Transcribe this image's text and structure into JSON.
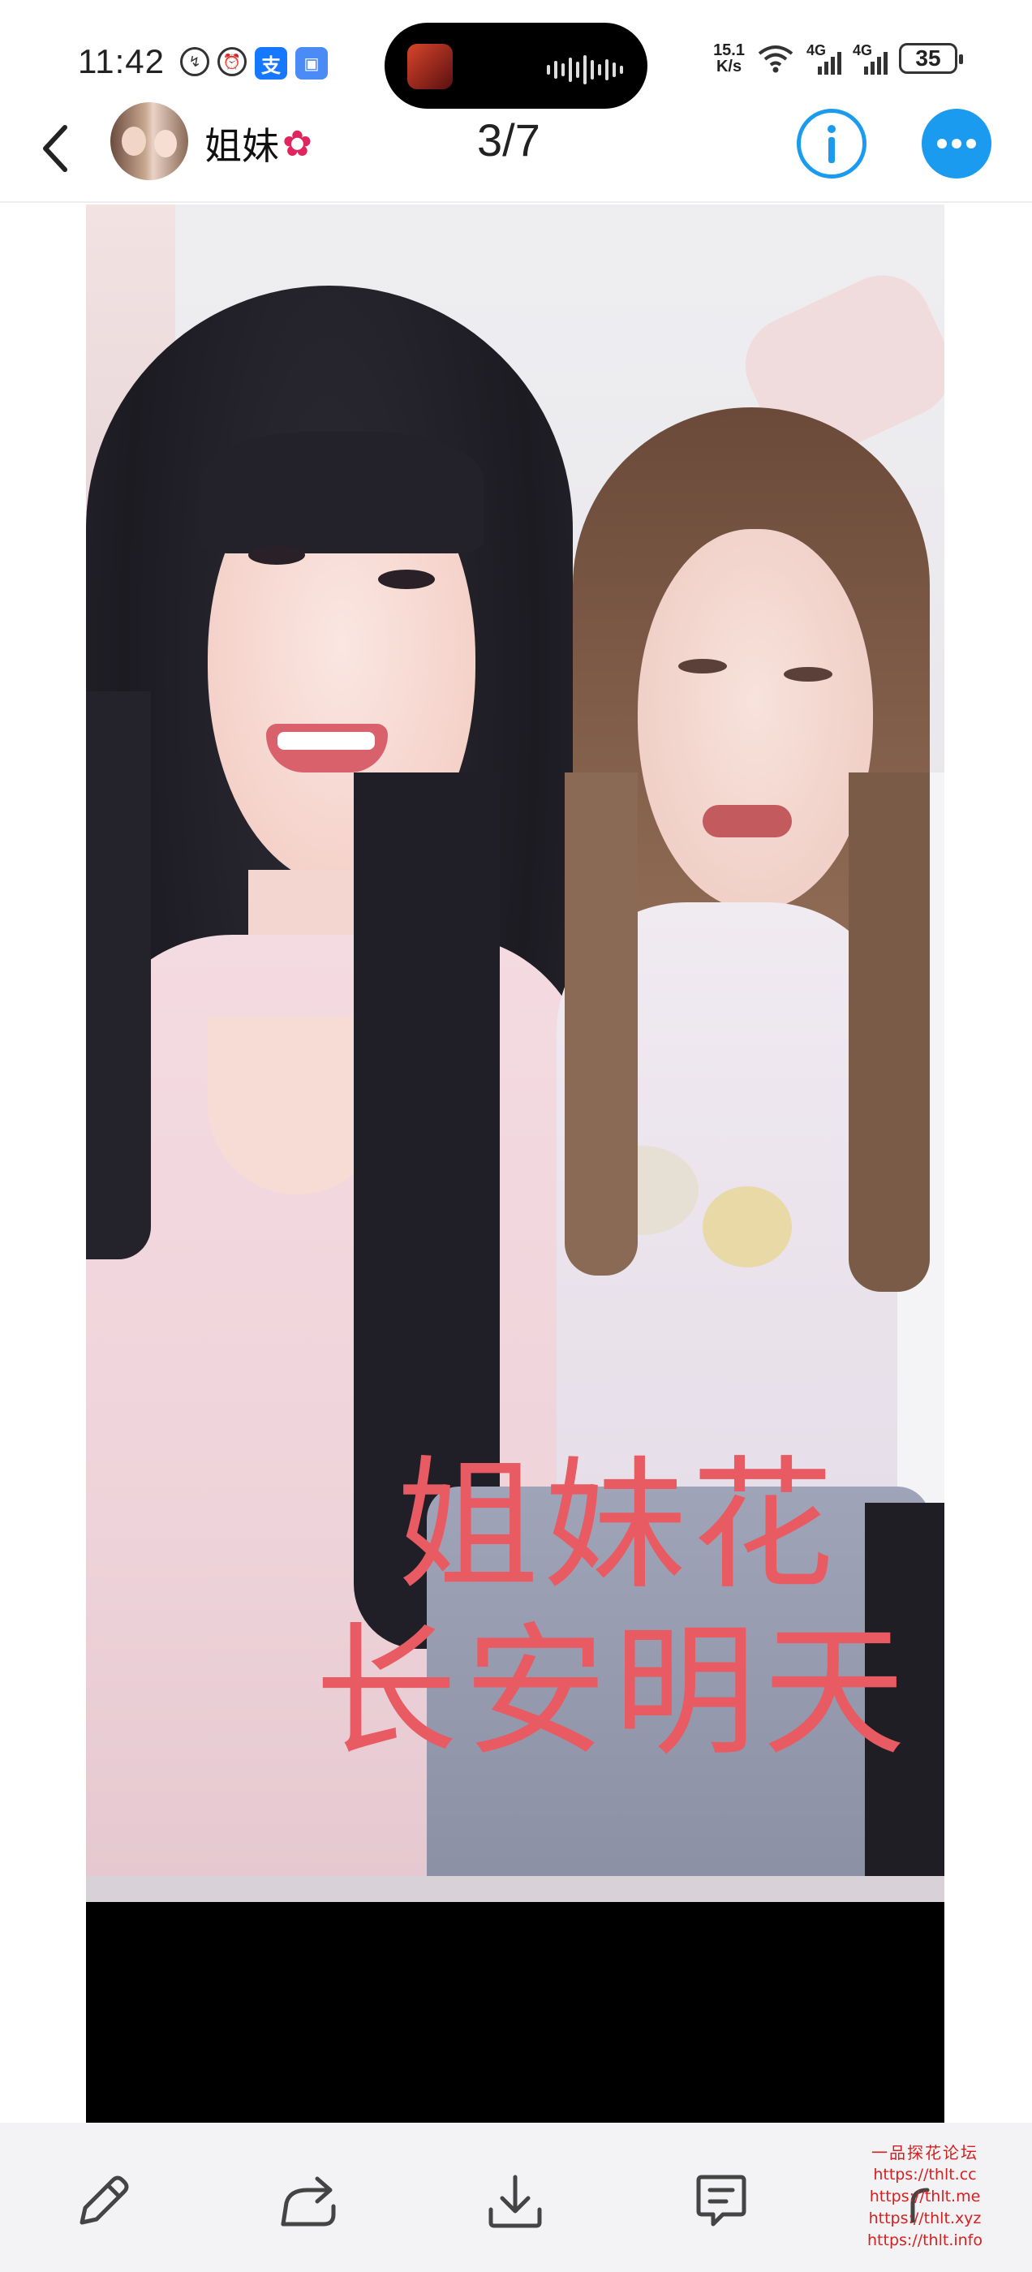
{
  "status_bar": {
    "time": "11:42",
    "net_speed_value": "15.1",
    "net_speed_unit": "K/s",
    "network_1": "4G",
    "network_2": "4G",
    "battery": "35"
  },
  "header": {
    "chat_name": "姐妹",
    "page_counter": "3/7"
  },
  "photo": {
    "overlay_line_1": "姐妹花",
    "overlay_line_2": "长安明天"
  },
  "toolbar": {
    "items": [
      "edit-icon",
      "share-icon",
      "download-icon",
      "comment-icon"
    ]
  },
  "watermark": {
    "title": "一品探花论坛",
    "urls": [
      "https://thlt.cc",
      "https://thlt.me",
      "https://thlt.xyz",
      "https://thlt.info"
    ]
  },
  "colors": {
    "accent": "#1a9bf0",
    "overlay_text": "#e85b63",
    "watermark": "#d62020",
    "toolbar_bg": "#f3f3f5"
  }
}
